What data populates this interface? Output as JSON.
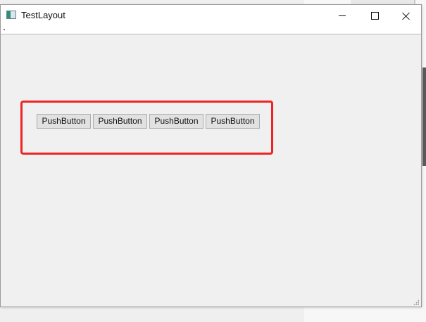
{
  "window": {
    "title": "TestLayout",
    "controls": {
      "minimize": "minimize",
      "maximize": "maximize",
      "close": "close"
    }
  },
  "content": {
    "buttons": [
      {
        "label": "PushButton"
      },
      {
        "label": "PushButton"
      },
      {
        "label": "PushButton"
      },
      {
        "label": "PushButton"
      }
    ]
  },
  "colors": {
    "highlight": "#ee2424",
    "window_bg": "#f0f0f0",
    "button_bg": "#e1e1e1",
    "titlebar_bg": "#ffffff"
  },
  "icons": {
    "app": "app-window-icon",
    "minimize": "minimize-icon",
    "maximize": "maximize-icon",
    "close": "close-icon",
    "resize": "size-grip-icon"
  }
}
